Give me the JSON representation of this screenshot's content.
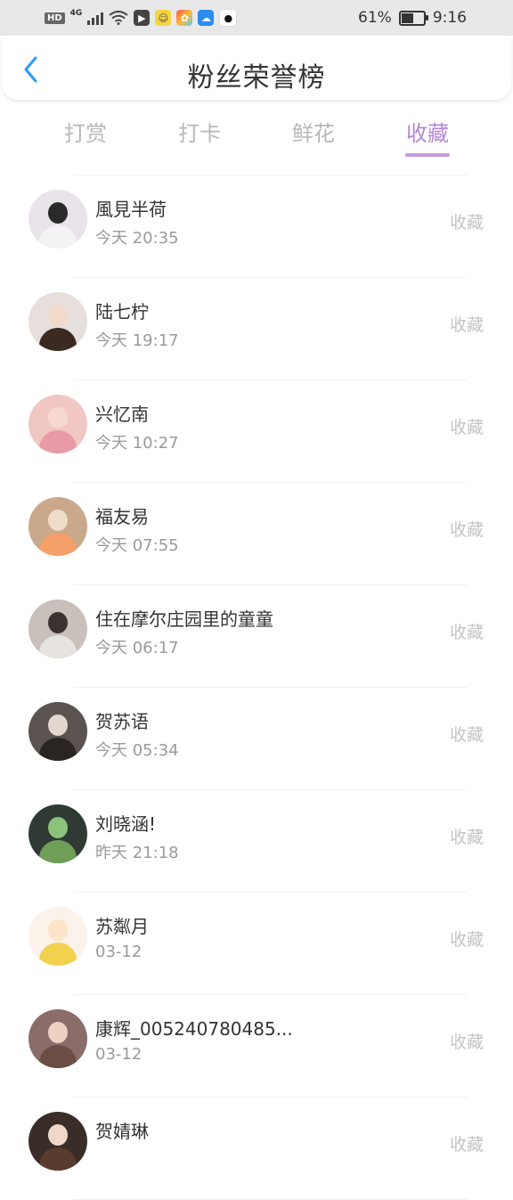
{
  "status_bar": {
    "hd": "HD",
    "network": "4G",
    "battery_percent": "61%",
    "battery_level": 0.61,
    "time": "9:16",
    "icons": [
      "wifi-icon",
      "app-icon",
      "app-icon",
      "app-icon",
      "cloud-icon",
      "qq-icon"
    ]
  },
  "header": {
    "title": "粉丝荣誉榜",
    "back_icon": "chevron-left-icon",
    "accent_color": "#2a9df4"
  },
  "tabs": [
    {
      "label": "打赏",
      "active": false
    },
    {
      "label": "打卡",
      "active": false
    },
    {
      "label": "鲜花",
      "active": false
    },
    {
      "label": "收藏",
      "active": true
    }
  ],
  "active_color": "#b288d6",
  "list": [
    {
      "name": "風見半荷",
      "time": "今天 20:35",
      "action": "收藏"
    },
    {
      "name": "陆七柠",
      "time": "今天 19:17",
      "action": "收藏"
    },
    {
      "name": "兴忆南",
      "time": "今天 10:27",
      "action": "收藏"
    },
    {
      "name": "福友易",
      "time": "今天 07:55",
      "action": "收藏"
    },
    {
      "name": "住在摩尔庄园里的童童",
      "time": "今天 06:17",
      "action": "收藏"
    },
    {
      "name": "贺苏语",
      "time": "今天 05:34",
      "action": "收藏"
    },
    {
      "name": "刘晓涵!",
      "time": "昨天 21:18",
      "action": "收藏"
    },
    {
      "name": "苏粼月",
      "time": "03-12",
      "action": "收藏"
    },
    {
      "name": "康辉_005240780485...",
      "time": "03-12",
      "action": "收藏"
    },
    {
      "name": "贺婧琳",
      "time": "",
      "action": "收藏"
    }
  ]
}
